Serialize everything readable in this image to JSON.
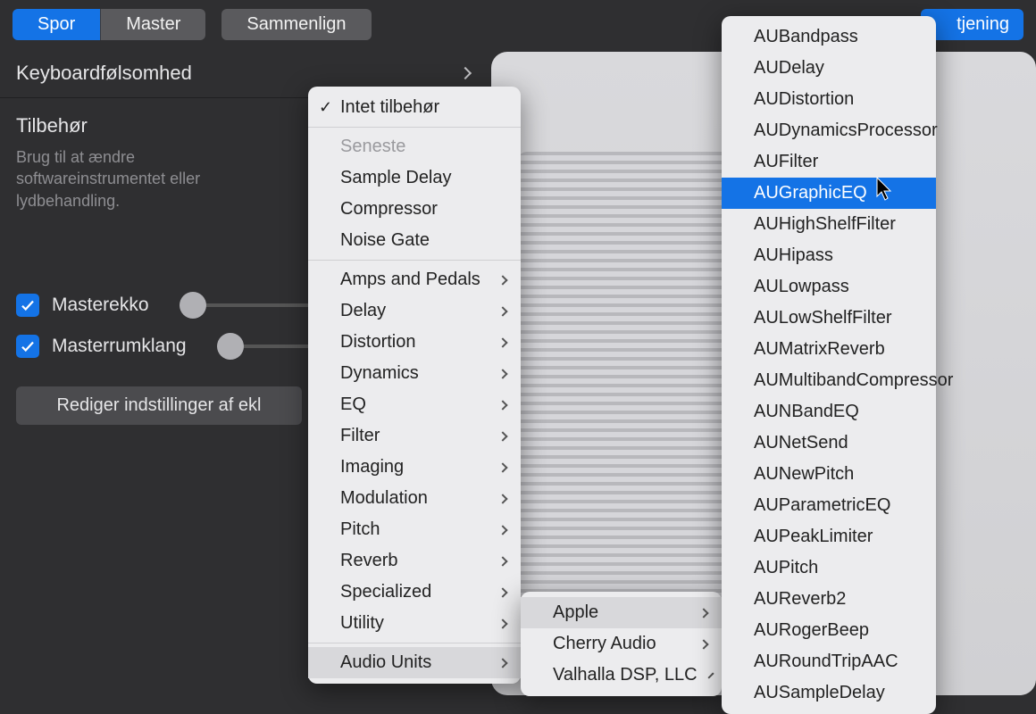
{
  "topbar": {
    "tab_track": "Spor",
    "tab_master": "Master",
    "compare": "Sammenlign",
    "right_button": "tjening"
  },
  "left": {
    "sensitivity": "Keyboardfølsomhed",
    "accessories": "Tilbehør",
    "help": "Brug til at ændre softwareinstrumentet eller lydbehandling.",
    "master_echo": "Masterekko",
    "master_reverb": "Masterrumklang",
    "edit_button": "Rediger indstillinger af ekl"
  },
  "menu1": {
    "no_plugin": "Intet tilbehør",
    "recent": "Seneste",
    "recent_items": [
      "Sample Delay",
      "Compressor",
      "Noise Gate"
    ],
    "categories": [
      "Amps and Pedals",
      "Delay",
      "Distortion",
      "Dynamics",
      "EQ",
      "Filter",
      "Imaging",
      "Modulation",
      "Pitch",
      "Reverb",
      "Specialized",
      "Utility"
    ],
    "audio_units": "Audio Units"
  },
  "menu2": {
    "vendors": [
      "Apple",
      "Cherry Audio",
      "Valhalla DSP, LLC"
    ]
  },
  "menu3": {
    "plugins": [
      "AUBandpass",
      "AUDelay",
      "AUDistortion",
      "AUDynamicsProcessor",
      "AUFilter",
      "AUGraphicEQ",
      "AUHighShelfFilter",
      "AUHipass",
      "AULowpass",
      "AULowShelfFilter",
      "AUMatrixReverb",
      "AUMultibandCompressor",
      "AUNBandEQ",
      "AUNetSend",
      "AUNewPitch",
      "AUParametricEQ",
      "AUPeakLimiter",
      "AUPitch",
      "AUReverb2",
      "AURogerBeep",
      "AURoundTripAAC",
      "AUSampleDelay"
    ],
    "highlighted": "AUGraphicEQ"
  }
}
